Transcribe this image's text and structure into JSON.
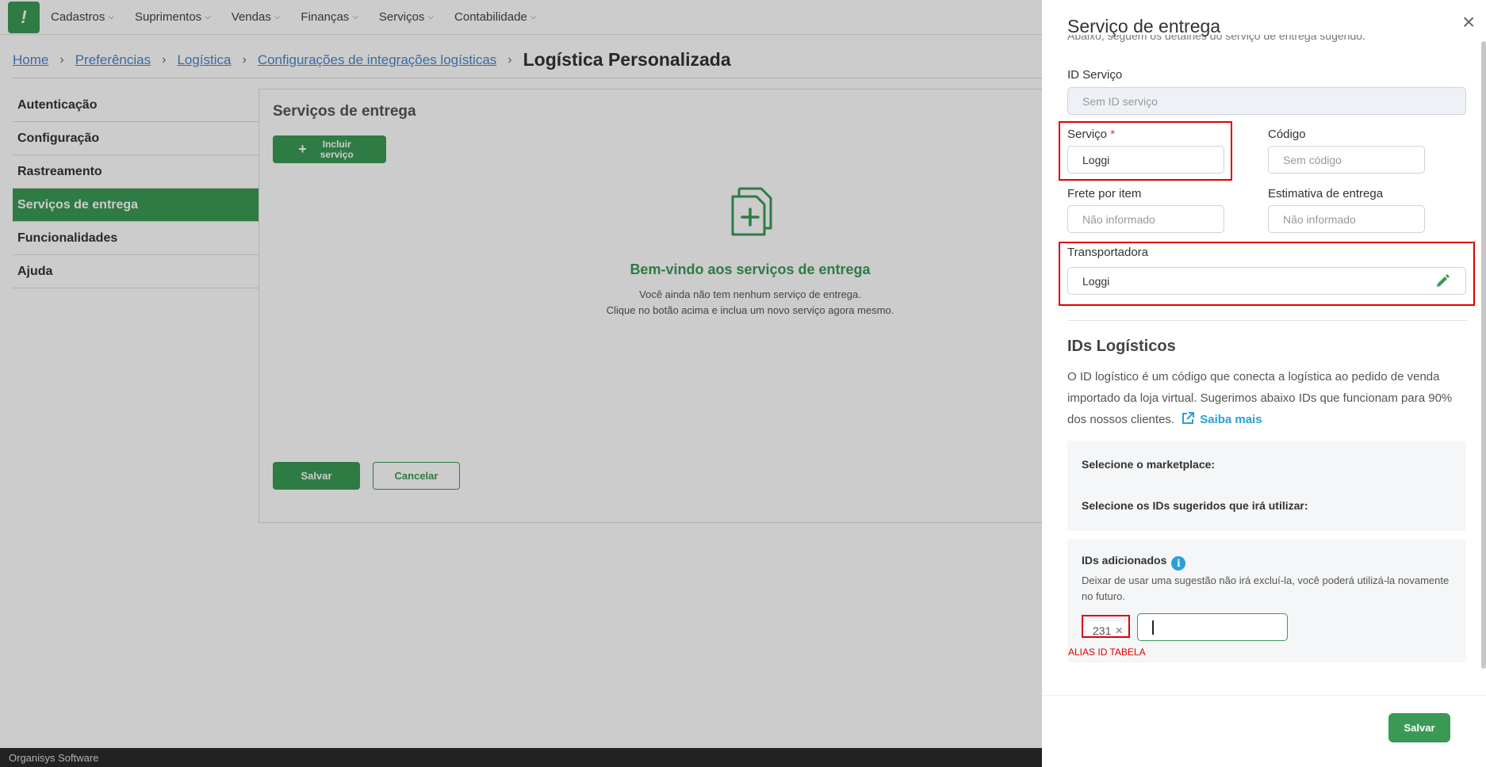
{
  "app": {
    "logo_text": "!",
    "menu": [
      {
        "label": "Cadastros"
      },
      {
        "label": "Suprimentos"
      },
      {
        "label": "Vendas"
      },
      {
        "label": "Finanças"
      },
      {
        "label": "Serviços"
      },
      {
        "label": "Contabilidade"
      }
    ],
    "breadcrumb": {
      "links": [
        "Home",
        "Preferências",
        "Logística",
        "Configurações de integrações logísticas"
      ],
      "current": "Logística Personalizada"
    },
    "sidenav": [
      {
        "label": "Autenticação",
        "active": false
      },
      {
        "label": "Configuração",
        "active": false
      },
      {
        "label": "Rastreamento",
        "active": false
      },
      {
        "label": "Serviços de entrega",
        "active": true
      },
      {
        "label": "Funcionalidades",
        "active": false
      },
      {
        "label": "Ajuda",
        "active": false
      }
    ],
    "content": {
      "title": "Serviços de entrega",
      "add_button": "Incluir serviço",
      "empty_title": "Bem-vindo aos serviços de entrega",
      "empty_line1": "Você ainda não tem nenhum serviço de entrega.",
      "empty_line2": "Clique no botão acima e inclua um novo serviço agora mesmo.",
      "save_button": "Salvar",
      "cancel_button": "Cancelar"
    },
    "footer": "Organisys Software"
  },
  "drawer": {
    "title": "Serviço de entrega",
    "subtitle": "Abaixo, seguem os detalhes do serviço de entrega sugerido.",
    "fields": {
      "id_servico": {
        "label": "ID Serviço",
        "placeholder": "Sem ID serviço",
        "value": ""
      },
      "servico": {
        "label": "Serviço",
        "required_mark": "*",
        "value": "Loggi"
      },
      "codigo": {
        "label": "Código",
        "placeholder": "Sem código",
        "value": ""
      },
      "frete": {
        "label": "Frete por item",
        "placeholder": "Não informado",
        "value": ""
      },
      "estimativa": {
        "label": "Estimativa de entrega",
        "placeholder": "Não informado",
        "value": ""
      },
      "transportadora": {
        "label": "Transportadora",
        "value": "Loggi"
      }
    },
    "ids_section": {
      "title": "IDs Logísticos",
      "description": "O ID logístico é um código que conecta a logística ao pedido de venda importado da loja virtual. Sugerimos abaixo IDs que funcionam para 90% dos nossos clientes.",
      "link": "Saiba mais",
      "marketplace_label": "Selecione o marketplace:",
      "suggested_label": "Selecione os IDs sugeridos que irá utilizar:",
      "added_label": "IDs adicionados",
      "added_help": "Deixar de usar uma sugestão não irá excluí-la, você poderá utilizá-la novamente no futuro.",
      "tags": [
        "231"
      ],
      "tag_remove": "✕",
      "annotation": "ALIAS ID TABELA"
    },
    "save_button": "Salvar",
    "close_icon": "×"
  },
  "colors": {
    "brand_green": "#3a9a55",
    "highlight_red": "#e00000",
    "link_blue": "#2a9fd6"
  }
}
